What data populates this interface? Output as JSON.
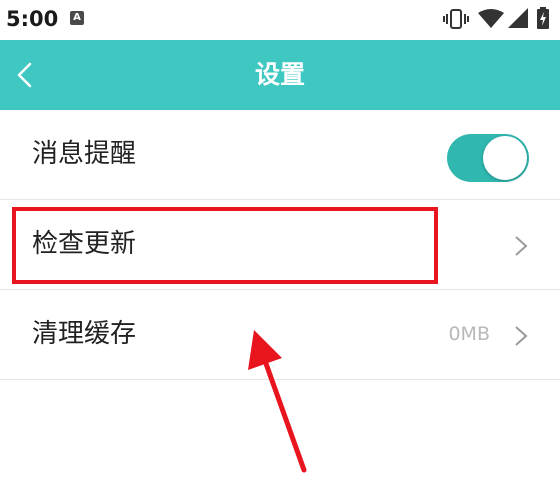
{
  "status_bar": {
    "time": "5:00",
    "app_badge": "A",
    "icons": [
      "vibrate-icon",
      "wifi-icon",
      "signal-icon",
      "battery-icon"
    ]
  },
  "app_bar": {
    "title": "设置",
    "back_icon": "chevron-left-icon",
    "color": "#3fc7c2"
  },
  "settings": {
    "notifications": {
      "label": "消息提醒",
      "toggle_on": true,
      "toggle_color": "#2fb7b0"
    },
    "check_update": {
      "label": "检查更新",
      "icon": "chevron-right-icon"
    },
    "clear_cache": {
      "label": "清理缓存",
      "value": "0MB",
      "icon": "chevron-right-icon"
    }
  },
  "annotation": {
    "highlight_color": "#e8141e"
  }
}
